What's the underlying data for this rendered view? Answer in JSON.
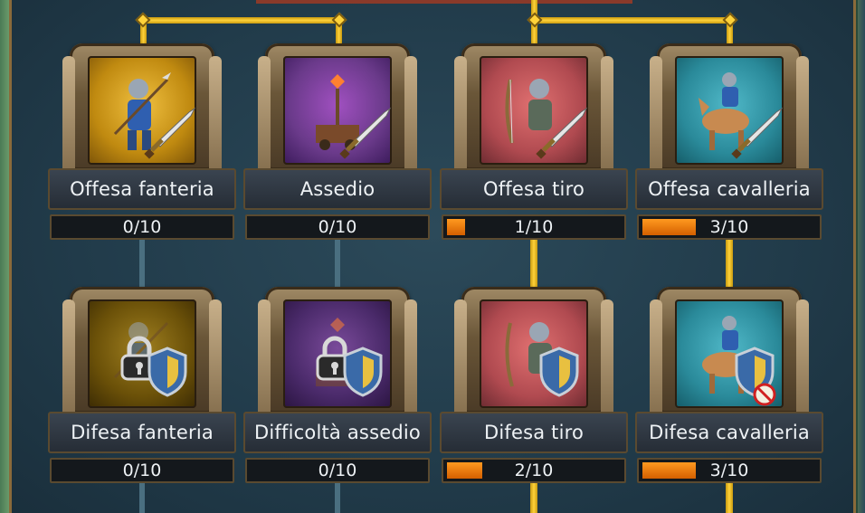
{
  "colors": {
    "gold_line": "#ffd23a",
    "inactive_line": "#4a6f80",
    "progress_fill": "#e07000"
  },
  "talents": {
    "row1": [
      {
        "name": "Offesa fanteria",
        "progress": "0/10",
        "level": 0,
        "max": 10,
        "icon": "infantry-attack-icon",
        "bg": "#c08a10"
      },
      {
        "name": "Assedio",
        "progress": "0/10",
        "level": 0,
        "max": 10,
        "icon": "siege-attack-icon",
        "bg": "#6a3a8a"
      },
      {
        "name": "Offesa tiro",
        "progress": "1/10",
        "level": 1,
        "max": 10,
        "icon": "archer-attack-icon",
        "bg": "#b04a50"
      },
      {
        "name": "Offesa cavalleria",
        "progress": "3/10",
        "level": 3,
        "max": 10,
        "icon": "cavalry-attack-icon",
        "bg": "#2a8a9a"
      }
    ],
    "row2": [
      {
        "name": "Difesa fanteria",
        "progress": "0/10",
        "level": 0,
        "max": 10,
        "icon": "infantry-defense-icon",
        "bg": "#8a6a10",
        "locked": true
      },
      {
        "name": "Difficoltà assedio",
        "progress": "0/10",
        "level": 0,
        "max": 10,
        "icon": "siege-defense-icon",
        "bg": "#4a2a6a",
        "locked": true
      },
      {
        "name": "Difesa tiro",
        "progress": "2/10",
        "level": 2,
        "max": 10,
        "icon": "archer-defense-icon",
        "bg": "#b04a50"
      },
      {
        "name": "Difesa cavalleria",
        "progress": "3/10",
        "level": 3,
        "max": 10,
        "icon": "cavalry-defense-icon",
        "bg": "#2a8a9a"
      }
    ]
  }
}
